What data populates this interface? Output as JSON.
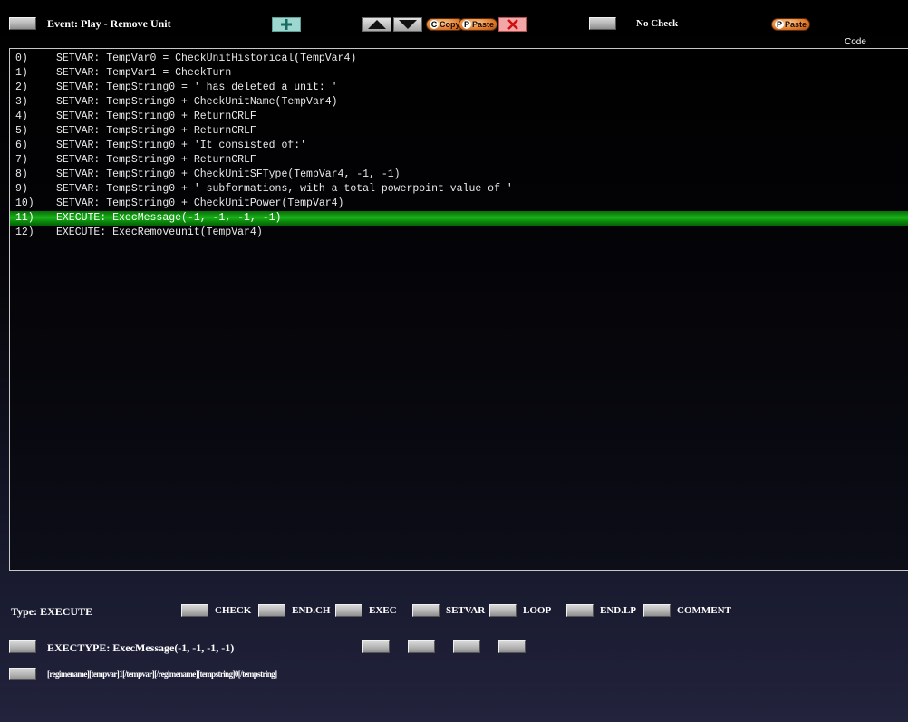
{
  "toolbar": {
    "event_title": "Event: Play - Remove Unit",
    "copy_label": "Copy",
    "paste_label": "Paste",
    "nocheck_label": "No Check",
    "paste2_label": "Paste",
    "code_label": "Code",
    "icons": [
      "plus-icon",
      "up-arrow-icon",
      "down-arrow-icon",
      "close-icon"
    ]
  },
  "code": {
    "selected_index": 11,
    "lines": [
      {
        "num": "0)",
        "text": "SETVAR: TempVar0 = CheckUnitHistorical(TempVar4)"
      },
      {
        "num": "1)",
        "text": "SETVAR: TempVar1 = CheckTurn"
      },
      {
        "num": "2)",
        "text": "SETVAR: TempString0 = ' has deleted a unit: '"
      },
      {
        "num": "3)",
        "text": "SETVAR: TempString0 + CheckUnitName(TempVar4)"
      },
      {
        "num": "4)",
        "text": "SETVAR: TempString0 + ReturnCRLF"
      },
      {
        "num": "5)",
        "text": "SETVAR: TempString0 + ReturnCRLF"
      },
      {
        "num": "6)",
        "text": "SETVAR: TempString0 + 'It consisted of:'"
      },
      {
        "num": "7)",
        "text": "SETVAR: TempString0 + ReturnCRLF"
      },
      {
        "num": "8)",
        "text": "SETVAR: TempString0 + CheckUnitSFType(TempVar4, -1, -1)"
      },
      {
        "num": "9)",
        "text": "SETVAR: TempString0 + ' subformations, with a total powerpoint value of '"
      },
      {
        "num": "10)",
        "text": "SETVAR: TempString0 + CheckUnitPower(TempVar4)"
      },
      {
        "num": "11)",
        "text": "EXECUTE: ExecMessage(-1, -1, -1, -1)"
      },
      {
        "num": "12)",
        "text": "EXECUTE: ExecRemoveunit(TempVar4)"
      }
    ]
  },
  "type_row": {
    "type_label": "Type: EXECUTE",
    "buttons": [
      "CHECK",
      "END.CH",
      "EXEC",
      "SETVAR",
      "LOOP",
      "END.LP",
      "COMMENT"
    ]
  },
  "exec_row": {
    "label": "EXECTYPE: ExecMessage(-1, -1, -1, -1)"
  },
  "param_row": {
    "label": "[regimename][tempvar]1[/tempvar][/regimename][tempstring]0[/tempstring]"
  }
}
